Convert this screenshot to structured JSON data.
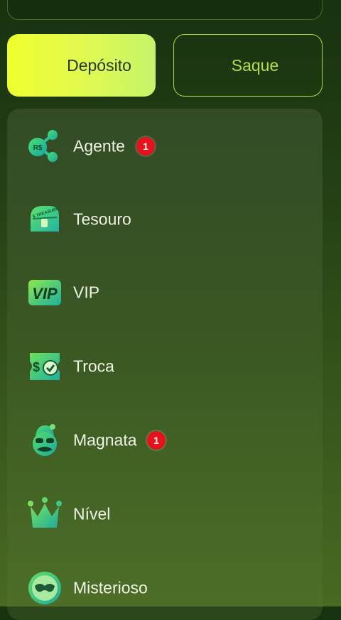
{
  "buttons": {
    "deposit": "Depósito",
    "withdraw": "Saque"
  },
  "menu": [
    {
      "label": "Agente",
      "icon": "network-money-icon",
      "badge": "1"
    },
    {
      "label": "Tesouro",
      "icon": "treasure-chest-icon",
      "badge": null
    },
    {
      "label": "VIP",
      "icon": "vip-icon",
      "badge": null
    },
    {
      "label": "Troca",
      "icon": "exchange-ticket-icon",
      "badge": null
    },
    {
      "label": "Magnata",
      "icon": "tycoon-face-icon",
      "badge": "1"
    },
    {
      "label": "Nível",
      "icon": "crown-icon",
      "badge": null
    },
    {
      "label": "Misterioso",
      "icon": "mystery-mask-icon",
      "badge": null
    }
  ],
  "icon_badge_text": {
    "agent": "R$",
    "chest": "$ TREASURE",
    "vip": "VIP",
    "exchange": "$"
  },
  "colors": {
    "accent": "#c8f04a",
    "badge": "#e8111b",
    "icon_green": "#3ed37a",
    "icon_teal": "#20b4a0"
  }
}
